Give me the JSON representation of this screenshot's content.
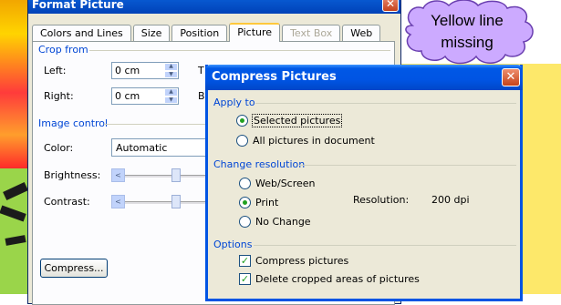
{
  "format_picture": {
    "title": "Format Picture",
    "tabs": [
      {
        "label": "Colors and Lines",
        "state": "normal"
      },
      {
        "label": "Size",
        "state": "normal"
      },
      {
        "label": "Position",
        "state": "normal"
      },
      {
        "label": "Picture",
        "state": "active"
      },
      {
        "label": "Text Box",
        "state": "disabled"
      },
      {
        "label": "Web",
        "state": "normal"
      }
    ],
    "crop_from": {
      "label": "Crop from",
      "left_label": "Left:",
      "left_value": "0 cm",
      "right_label": "Right:",
      "right_value": "0 cm",
      "top_partial": "T",
      "bottom_partial": "B"
    },
    "image_control": {
      "label": "Image control",
      "color_label": "Color:",
      "color_value": "Automatic",
      "brightness_label": "Brightness:",
      "contrast_label": "Contrast:"
    },
    "compress_button": "Compress..."
  },
  "compress_pictures": {
    "title": "Compress Pictures",
    "apply_to": {
      "label": "Apply to",
      "options": [
        {
          "label": "Selected pictures",
          "selected": true
        },
        {
          "label": "All pictures in document",
          "selected": false
        }
      ]
    },
    "change_resolution": {
      "label": "Change resolution",
      "options": [
        {
          "label": "Web/Screen",
          "selected": false
        },
        {
          "label": "Print",
          "selected": true
        },
        {
          "label": "No Change",
          "selected": false
        }
      ],
      "resolution_label": "Resolution:",
      "resolution_value": "200 dpi"
    },
    "options": {
      "label": "Options",
      "checkboxes": [
        {
          "label": "Compress pictures",
          "checked": true
        },
        {
          "label": "Delete cropped areas of pictures",
          "checked": true
        }
      ]
    }
  },
  "callout": {
    "text_line1": "Yellow line",
    "text_line2": "missing",
    "fill_color": "#ccaaff"
  }
}
